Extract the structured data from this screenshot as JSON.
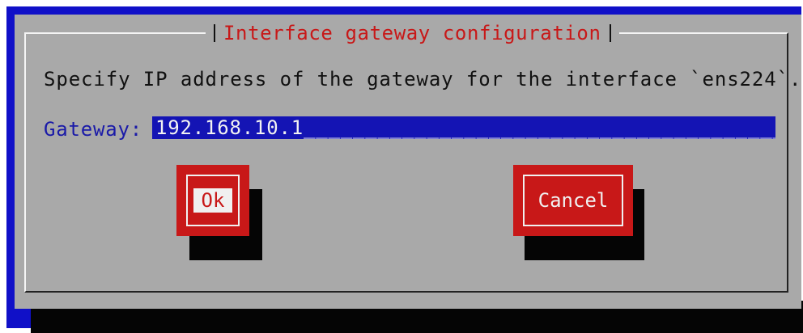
{
  "dialog": {
    "title": "Interface gateway configuration",
    "prompt": "Specify IP address of the gateway for the interface `ens224`.",
    "gateway_label": "Gateway:",
    "gateway_value": "192.168.10.1________________________________________"
  },
  "buttons": {
    "ok": "Ok",
    "cancel": "Cancel"
  },
  "colors": {
    "background_blue": "#1010c8",
    "dialog_gray": "#a9a9a9",
    "accent_red": "#c81818",
    "input_blue": "#1414b4",
    "shadow": "#050505"
  }
}
